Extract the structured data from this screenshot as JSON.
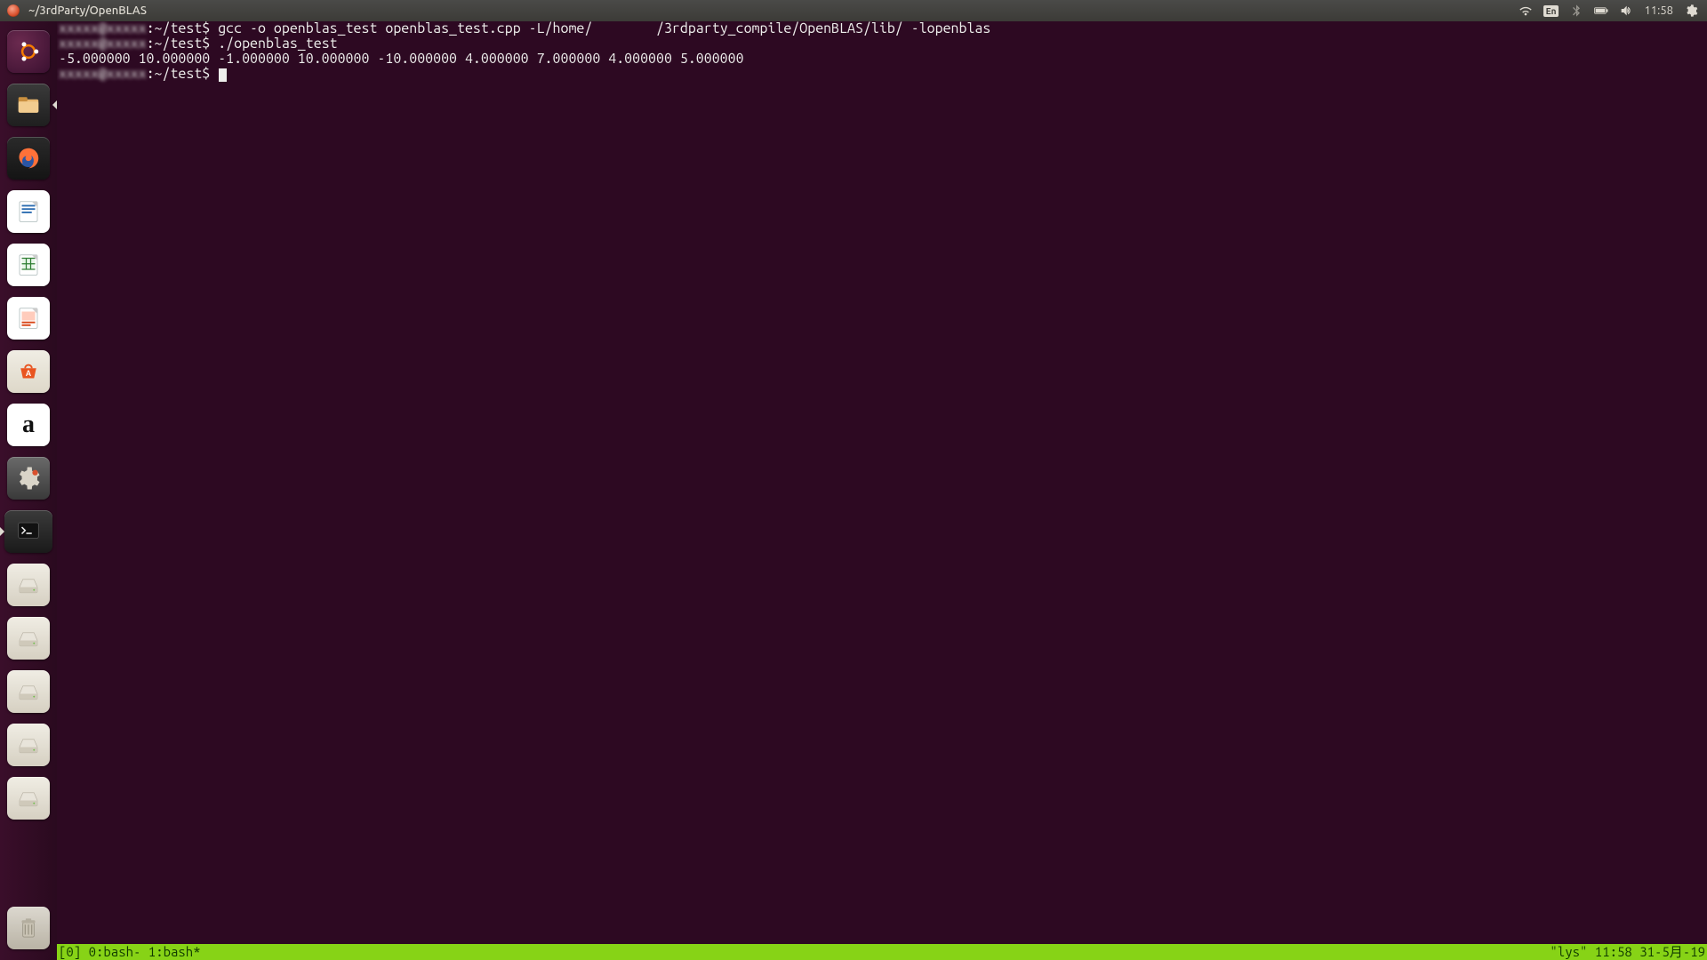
{
  "menubar": {
    "title": "~/3rdParty/OpenBLAS",
    "lang": "En",
    "clock": "11:58"
  },
  "launcher": {
    "items": [
      {
        "name": "ubuntu-dash-icon"
      },
      {
        "name": "files-icon"
      },
      {
        "name": "firefox-icon"
      },
      {
        "name": "libreoffice-writer-icon"
      },
      {
        "name": "libreoffice-calc-icon"
      },
      {
        "name": "libreoffice-impress-icon"
      },
      {
        "name": "ubuntu-software-icon"
      },
      {
        "name": "amazon-icon"
      },
      {
        "name": "system-settings-icon"
      },
      {
        "name": "terminal-icon"
      },
      {
        "name": "drive-icon"
      },
      {
        "name": "drive-icon"
      },
      {
        "name": "drive-icon"
      },
      {
        "name": "drive-icon"
      },
      {
        "name": "drive-icon"
      }
    ],
    "amazon_glyph": "a",
    "trash": {
      "name": "trash-icon"
    }
  },
  "terminal": {
    "prompt_suffix": ":~/test$",
    "cmd1": " gcc -o openblas_test openblas_test.cpp -L/home/        /3rdparty_compile/OpenBLAS/lib/ -lopenblas",
    "cmd2": " ./openblas_test",
    "output": "-5.000000 10.000000 -1.000000 10.000000 -10.000000 4.000000 7.000000 4.000000 5.000000"
  },
  "tmux": {
    "left": "[0] 0:bash- 1:bash*",
    "right": "\"lys\" 11:58 31-5月-19"
  }
}
